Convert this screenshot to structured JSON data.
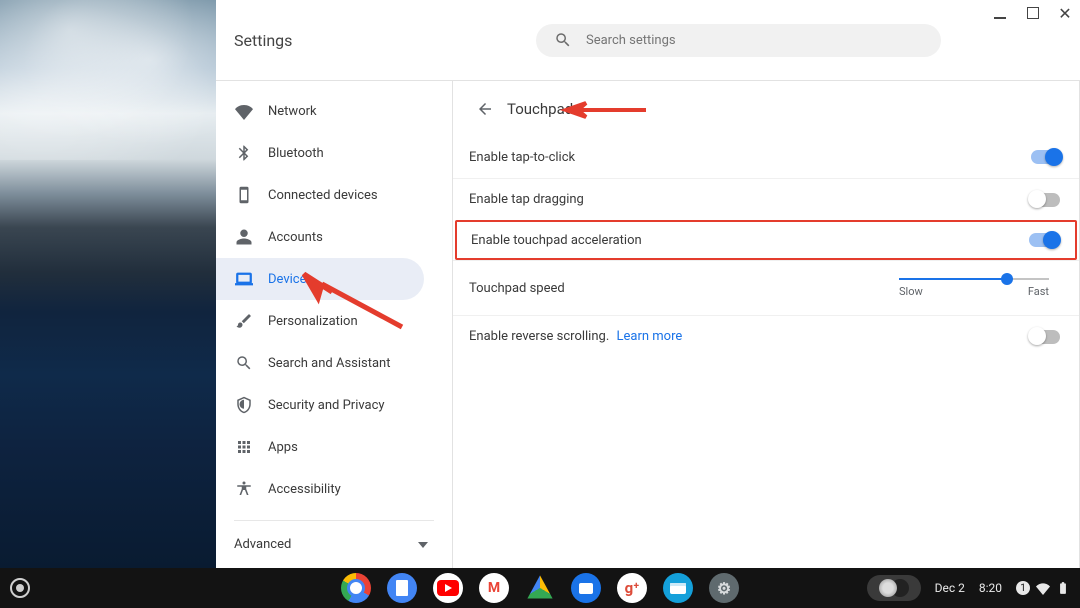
{
  "window": {
    "title": "Settings",
    "search_placeholder": "Search settings"
  },
  "nav": {
    "items": [
      {
        "id": "network",
        "label": "Network"
      },
      {
        "id": "bluetooth",
        "label": "Bluetooth"
      },
      {
        "id": "connected-devices",
        "label": "Connected devices"
      },
      {
        "id": "accounts",
        "label": "Accounts"
      },
      {
        "id": "device",
        "label": "Device"
      },
      {
        "id": "personalization",
        "label": "Personalization"
      },
      {
        "id": "search-and-assistant",
        "label": "Search and Assistant"
      },
      {
        "id": "security-and-privacy",
        "label": "Security and Privacy"
      },
      {
        "id": "apps",
        "label": "Apps"
      },
      {
        "id": "accessibility",
        "label": "Accessibility"
      }
    ],
    "active": "device",
    "advanced_label": "Advanced"
  },
  "page": {
    "title": "Touchpad",
    "rows": {
      "tap_to_click": {
        "label": "Enable tap-to-click",
        "value": true
      },
      "tap_dragging": {
        "label": "Enable tap dragging",
        "value": false
      },
      "accel": {
        "label": "Enable touchpad acceleration",
        "value": true,
        "highlighted": true
      },
      "speed": {
        "label": "Touchpad speed",
        "value": 0.72,
        "min_label": "Slow",
        "max_label": "Fast"
      },
      "reverse": {
        "label": "Enable reverse scrolling.",
        "learn_more": "Learn more",
        "value": false
      }
    }
  },
  "shelf": {
    "apps": [
      {
        "id": "chrome",
        "name": "Chrome"
      },
      {
        "id": "docs",
        "name": "Docs"
      },
      {
        "id": "yt",
        "name": "YouTube"
      },
      {
        "id": "gmail",
        "name": "Gmail"
      },
      {
        "id": "drive",
        "name": "Drive"
      },
      {
        "id": "msgs",
        "name": "Messages"
      },
      {
        "id": "gplus",
        "name": "Google+"
      },
      {
        "id": "files",
        "name": "Files"
      },
      {
        "id": "sys",
        "name": "Settings"
      }
    ],
    "date": "Dec 2",
    "time": "8:20",
    "notification_count": "1"
  },
  "colors": {
    "accent": "#1a73e8",
    "highlight_border": "#e43c2d"
  }
}
